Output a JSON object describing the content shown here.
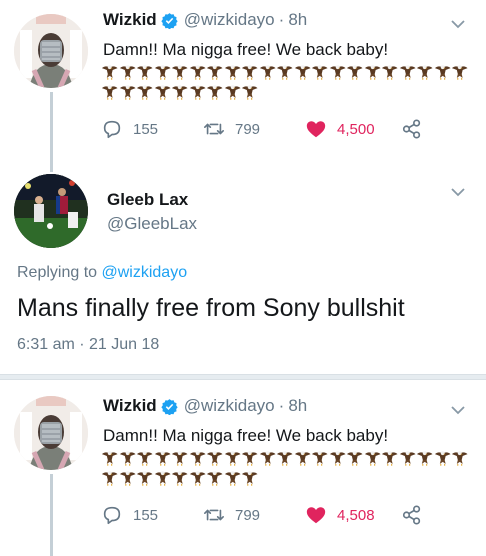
{
  "tweets": [
    {
      "name": "Wizkid",
      "handle": "@wizkidayo",
      "separator": "·",
      "time": "8h",
      "text": "Damn!! Ma nigga free! We back baby!",
      "emoji": "eagle",
      "emoji_count": 30,
      "replies": "155",
      "retweets": "799",
      "likes": "4,500"
    },
    {
      "name": "Wizkid",
      "handle": "@wizkidayo",
      "separator": "·",
      "time": "8h",
      "text": "Damn!! Ma nigga free! We back baby!",
      "emoji": "eagle",
      "emoji_count": 30,
      "replies": "155",
      "retweets": "799",
      "likes": "4,508"
    }
  ],
  "reply": {
    "name": "Gleeb Lax",
    "handle": "@GleebLax",
    "replying_prefix": "Replying to",
    "replying_to": "@wizkidayo",
    "text": "Mans finally free from Sony bullshit",
    "timestamp": "6:31 am · 21 Jun 18"
  },
  "colors": {
    "accent": "#1da1f2",
    "like": "#e0245e",
    "secondary_text": "#657786",
    "thread_line": "#c4cfd6"
  },
  "icons": [
    "verified-badge-icon",
    "chevron-down-icon",
    "reply-icon",
    "retweet-icon",
    "heart-icon",
    "share-icon",
    "eagle-emoji-icon"
  ]
}
